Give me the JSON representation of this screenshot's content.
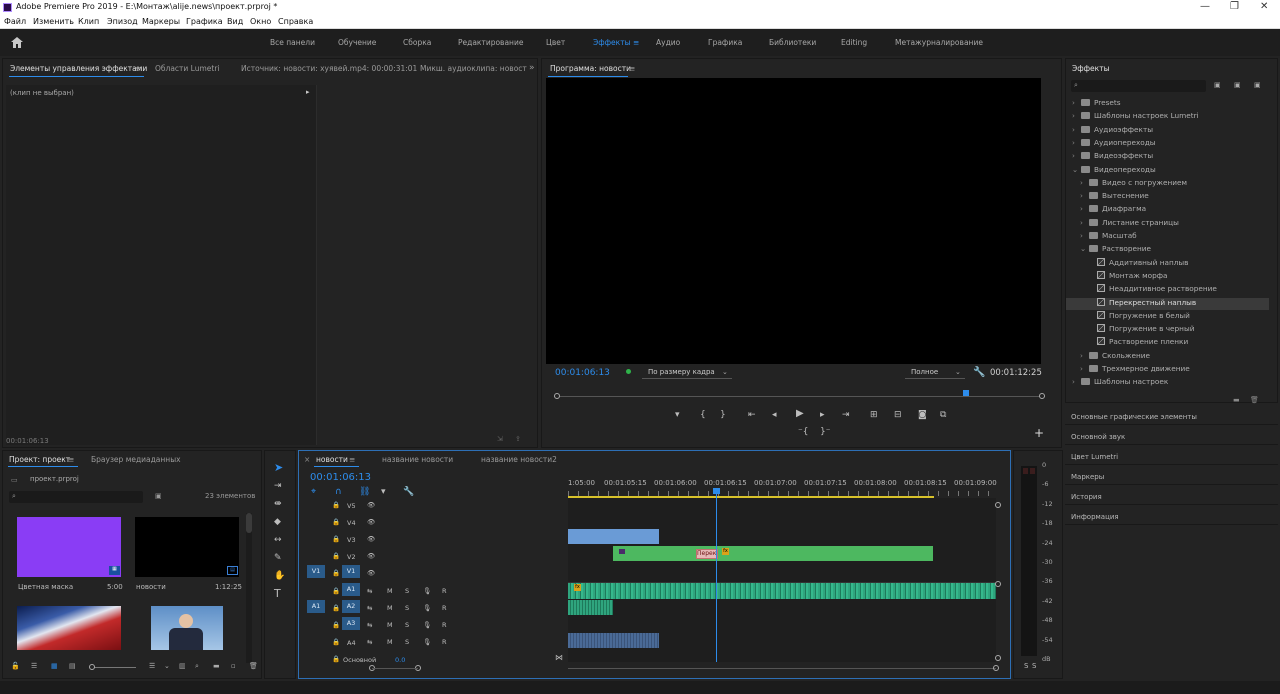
{
  "window": {
    "title": "Adobe Premiere Pro 2019 - E:\\Монтаж\\alije.news\\проект.prproj *",
    "minimize": "—",
    "restore": "❐",
    "close": "✕"
  },
  "menu": [
    "Файл",
    "Изменить",
    "Клип",
    "Эпизод",
    "Маркеры",
    "Графика",
    "Вид",
    "Окно",
    "Справка"
  ],
  "workspaces": {
    "items": [
      "Все панели",
      "Обучение",
      "Сборка",
      "Редактирование",
      "Цвет",
      "Эффекты",
      "Аудио",
      "Графика",
      "Библиотеки",
      "Editing",
      "Метажурналирование"
    ],
    "active": "Эффекты"
  },
  "source_panel": {
    "tabs": [
      "Элементы управления эффектами",
      "Области Lumetri",
      "Источник: новости: хуявей.mp4: 00:00:31:01",
      "Микш. аудиоклипа: новост"
    ],
    "active_tab": "Элементы управления эффектами",
    "no_clip": "(клип не выбран)",
    "timecode": "00:01:06:13"
  },
  "program": {
    "title": "Программа: новости",
    "timecode": "00:01:06:13",
    "fit": "По размеру кадра",
    "quality": "Полное",
    "duration": "00:01:12:25",
    "playhead_fraction": 0.84
  },
  "effects": {
    "title": "Эффекты",
    "search_placeholder": "",
    "tree": [
      {
        "label": "Presets",
        "type": "folder",
        "level": 0,
        "open": false
      },
      {
        "label": "Шаблоны настроек Lumetri",
        "type": "folder",
        "level": 0,
        "open": false
      },
      {
        "label": "Аудиоэффекты",
        "type": "folder",
        "level": 0,
        "open": false
      },
      {
        "label": "Аудиопереходы",
        "type": "folder",
        "level": 0,
        "open": false
      },
      {
        "label": "Видеоэффекты",
        "type": "folder",
        "level": 0,
        "open": false
      },
      {
        "label": "Видеопереходы",
        "type": "folder",
        "level": 0,
        "open": true
      },
      {
        "label": "Видео с погружением",
        "type": "folder",
        "level": 1,
        "open": false
      },
      {
        "label": "Вытеснение",
        "type": "folder",
        "level": 1,
        "open": false
      },
      {
        "label": "Диафрагма",
        "type": "folder",
        "level": 1,
        "open": false
      },
      {
        "label": "Листание страницы",
        "type": "folder",
        "level": 1,
        "open": false
      },
      {
        "label": "Масштаб",
        "type": "folder",
        "level": 1,
        "open": false
      },
      {
        "label": "Растворение",
        "type": "folder",
        "level": 1,
        "open": true
      },
      {
        "label": "Аддитивный наплыв",
        "type": "fx",
        "level": 2
      },
      {
        "label": "Монтаж морфа",
        "type": "fx",
        "level": 2
      },
      {
        "label": "Неаддитивное растворение",
        "type": "fx",
        "level": 2
      },
      {
        "label": "Перекрестный наплыв",
        "type": "fx",
        "level": 2,
        "selected": true
      },
      {
        "label": "Погружение в белый",
        "type": "fx",
        "level": 2
      },
      {
        "label": "Погружение в черный",
        "type": "fx",
        "level": 2
      },
      {
        "label": "Растворение пленки",
        "type": "fx",
        "level": 2
      },
      {
        "label": "Скольжение",
        "type": "folder",
        "level": 1,
        "open": false
      },
      {
        "label": "Трехмерное движение",
        "type": "folder",
        "level": 1,
        "open": false
      },
      {
        "label": "Шаблоны настроек",
        "type": "folder",
        "level": 0,
        "open": false
      }
    ],
    "collapsed_panels": [
      "Основные графические элементы",
      "Основной звук",
      "Цвет Lumetri",
      "Маркеры",
      "История",
      "Информация"
    ]
  },
  "project": {
    "tabs": [
      "Проект: проект",
      "Браузер медиаданных"
    ],
    "file": "проект.prproj",
    "count": "23 элементов",
    "items": [
      {
        "name": "Цветная маска",
        "duration": "5:00",
        "color": "#8a3df5"
      },
      {
        "name": "новости",
        "duration": "1:12:25",
        "color": "#000000"
      },
      {
        "name": "",
        "duration": "",
        "color": "#c22a2a"
      },
      {
        "name": "",
        "duration": "",
        "color": "#6fa0d0"
      }
    ]
  },
  "timeline": {
    "tabs": [
      "новости",
      "название новости",
      "название новости2"
    ],
    "active_tab": "новости",
    "timecode": "00:01:06:13",
    "ruler": [
      "1:05:00",
      "00:01:05:15",
      "00:01:06:00",
      "00:01:06:15",
      "00:01:07:00",
      "00:01:07:15",
      "00:01:08:00",
      "00:01:08:15",
      "00:01:09:00"
    ],
    "video_tracks": [
      "V5",
      "V4",
      "V3",
      "V2",
      "V1"
    ],
    "audio_tracks": [
      "A1",
      "A2",
      "A3",
      "A4"
    ],
    "source_v": "V1",
    "source_a": "A1",
    "mute": "M",
    "solo": "S",
    "record": "R",
    "master": "Основной",
    "master_value": "0.0",
    "transition_label": "Перек",
    "meter_scale": [
      "0",
      "-6",
      "-12",
      "-18",
      "-24",
      "-30",
      "-36",
      "-42",
      "-48",
      "-54",
      "dB"
    ],
    "meter_solo": [
      "S",
      "S"
    ]
  },
  "colors": {
    "accent": "#2d8ceb",
    "video_clip": "#4db860",
    "audio_clip": "#2fa57e",
    "v3_clip": "#6a9bd6"
  }
}
